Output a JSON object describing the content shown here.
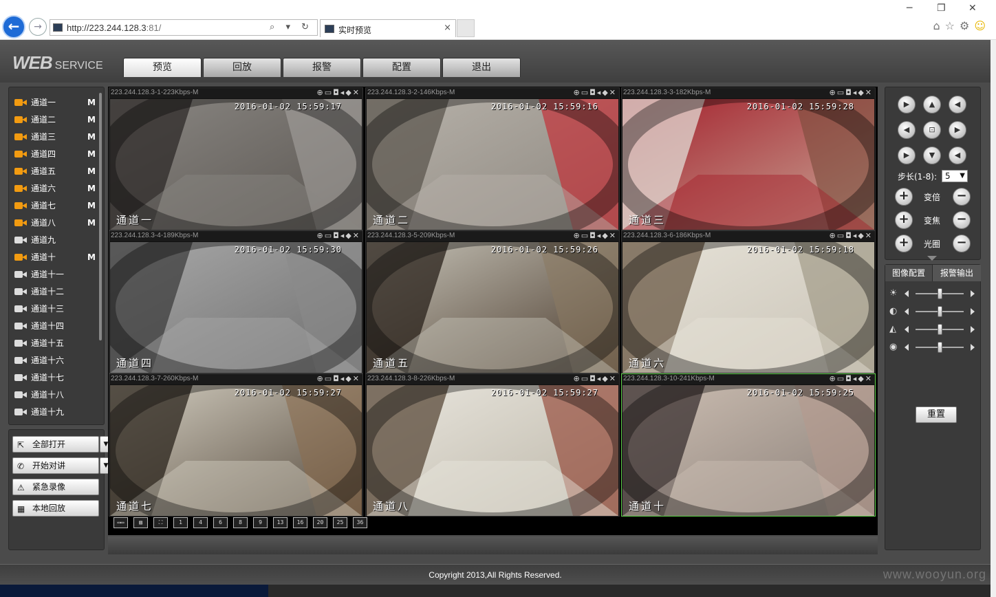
{
  "browser": {
    "url_main": "http://223.244.128.3",
    "url_rest": ":81/",
    "tab_title": "实时预览",
    "tab_close": "×",
    "win_min": "─",
    "win_max": "❐",
    "win_close": "✕",
    "addr_tools": "⌕ ▾ ↻"
  },
  "app": {
    "logo_web": "WEB",
    "logo_service": "SERVICE",
    "tabs": [
      "预览",
      "回放",
      "报警",
      "配置",
      "退出"
    ],
    "active_tab": 0
  },
  "channels": [
    {
      "name": "通道一",
      "flag": "M",
      "on": true
    },
    {
      "name": "通道二",
      "flag": "M",
      "on": true
    },
    {
      "name": "通道三",
      "flag": "M",
      "on": true
    },
    {
      "name": "通道四",
      "flag": "M",
      "on": true
    },
    {
      "name": "通道五",
      "flag": "M",
      "on": true
    },
    {
      "name": "通道六",
      "flag": "M",
      "on": true
    },
    {
      "name": "通道七",
      "flag": "M",
      "on": true
    },
    {
      "name": "通道八",
      "flag": "M",
      "on": true
    },
    {
      "name": "通道九",
      "flag": "",
      "on": false
    },
    {
      "name": "通道十",
      "flag": "M",
      "on": true
    },
    {
      "name": "通道十一",
      "flag": "",
      "on": false
    },
    {
      "name": "通道十二",
      "flag": "",
      "on": false
    },
    {
      "name": "通道十三",
      "flag": "",
      "on": false
    },
    {
      "name": "通道十四",
      "flag": "",
      "on": false
    },
    {
      "name": "通道十五",
      "flag": "",
      "on": false
    },
    {
      "name": "通道十六",
      "flag": "",
      "on": false
    },
    {
      "name": "通道十七",
      "flag": "",
      "on": false
    },
    {
      "name": "通道十八",
      "flag": "",
      "on": false
    },
    {
      "name": "通道十九",
      "flag": "",
      "on": false
    }
  ],
  "left_buttons": {
    "open_all": "全部打开",
    "start_talk": "开始对讲",
    "emergency_record": "紧急录像",
    "local_playback": "本地回放"
  },
  "tiles": [
    {
      "info": "223.244.128.3-1-223Kbps-M",
      "timestamp": "2016-01-02 15:59:17",
      "channel": "通道一",
      "selected": false,
      "palette": [
        "#5a5550",
        "#8a8783",
        "#2d2a28",
        "#a5a29e"
      ]
    },
    {
      "info": "223.244.128.3-2-146Kbps-M",
      "timestamp": "2016-01-02 15:59:16",
      "channel": "通道二",
      "selected": false,
      "palette": [
        "#8d877f",
        "#b7b2aa",
        "#5c574f",
        "#c8202a"
      ]
    },
    {
      "info": "223.244.128.3-3-182Kbps-M",
      "timestamp": "2016-01-02 15:59:28",
      "channel": "通道三",
      "selected": false,
      "palette": [
        "#c9a898",
        "#a31f2b",
        "#e2dcd5",
        "#7a4b3b"
      ]
    },
    {
      "info": "223.244.128.3-4-189Kbps-M",
      "timestamp": "2016-01-02 15:59:30",
      "channel": "通道四",
      "selected": false,
      "palette": [
        "#6e6e6e",
        "#a9a9a9",
        "#3d3d3d",
        "#8b8b8b"
      ]
    },
    {
      "info": "223.244.128.3-5-209Kbps-M",
      "timestamp": "2016-01-02 15:59:26",
      "channel": "通道五",
      "selected": false,
      "palette": [
        "#4b3b2d",
        "#c6c3b8",
        "#2a221b",
        "#8a7a62"
      ]
    },
    {
      "info": "223.244.128.3-6-186Kbps-M",
      "timestamp": "2016-01-02 15:59:18",
      "channel": "通道六",
      "selected": false,
      "palette": [
        "#c9c3b6",
        "#e6e2d8",
        "#6a5844",
        "#9a927f"
      ]
    },
    {
      "info": "223.244.128.3-7-260Kbps-M",
      "timestamp": "2016-01-02 15:59:27",
      "channel": "通道七",
      "selected": false,
      "palette": [
        "#55493c",
        "#d3cec1",
        "#2b241c",
        "#8b6d4f"
      ]
    },
    {
      "info": "223.244.128.3-8-226Kbps-M",
      "timestamp": "2016-01-02 15:59:27",
      "channel": "通道八",
      "selected": false,
      "palette": [
        "#bcb6a8",
        "#e9e6de",
        "#5a4a3a",
        "#8d3b2a"
      ]
    },
    {
      "info": "223.244.128.3-10-241Kbps-M",
      "timestamp": "2016-01-02 15:59:25",
      "channel": "通道十",
      "selected": true,
      "palette": [
        "#8a7f78",
        "#cdbfb3",
        "#3a3030",
        "#b49a8e"
      ]
    }
  ],
  "tile_icons": "⊕▭◘◂◆✕",
  "layout_buttons": [
    "▭▭",
    "▨",
    "⛶",
    "1",
    "4",
    "6",
    "8",
    "9",
    "13",
    "16",
    "20",
    "25",
    "36"
  ],
  "ptz": {
    "step_label": "步长(1-8):",
    "step_value": "5",
    "zoom_label": "变倍",
    "focus_label": "变焦",
    "iris_label": "光圈",
    "plus": "+",
    "minus": "−"
  },
  "image_config": {
    "tab_image": "图像配置",
    "tab_alarm": "报警输出",
    "sliders": [
      {
        "icon": "☀",
        "value": 0.5
      },
      {
        "icon": "◐",
        "value": 0.5
      },
      {
        "icon": "◭",
        "value": 0.5
      },
      {
        "icon": "◉",
        "value": 0.5
      }
    ],
    "reset": "重置"
  },
  "footer": {
    "copyright": "Copyright 2013,All Rights Reserved.",
    "watermark": "www.wooyun.org"
  }
}
